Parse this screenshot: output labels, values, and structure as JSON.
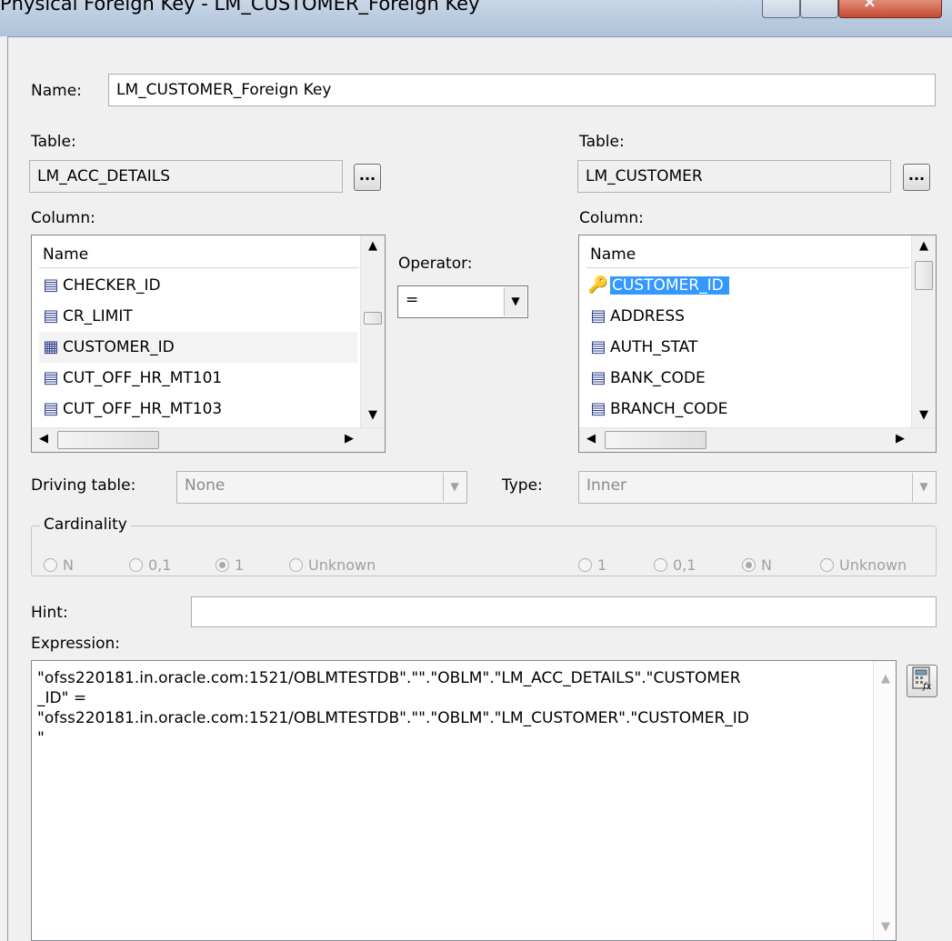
{
  "window": {
    "title": "Physical Foreign Key - LM_CUSTOMER_Foreign Key"
  },
  "name": {
    "label": "Name:",
    "value": "LM_CUSTOMER_Foreign Key"
  },
  "left": {
    "table_label": "Table:",
    "table_value": "LM_ACC_DETAILS",
    "browse_label": "...",
    "column_label": "Column:",
    "list_header": "Name",
    "columns": [
      {
        "name": "CHECKER_ID",
        "icon": "column-icon"
      },
      {
        "name": "CR_LIMIT",
        "icon": "column-icon"
      },
      {
        "name": "CUSTOMER_ID",
        "icon": "column-icon"
      },
      {
        "name": "CUT_OFF_HR_MT101",
        "icon": "column-icon"
      },
      {
        "name": "CUT_OFF_HR_MT103",
        "icon": "column-icon"
      }
    ]
  },
  "operator": {
    "label": "Operator:",
    "value": "="
  },
  "right": {
    "table_label": "Table:",
    "table_value": "LM_CUSTOMER",
    "browse_label": "...",
    "column_label": "Column:",
    "list_header": "Name",
    "columns": [
      {
        "name": "CUSTOMER_ID",
        "icon": "key-icon"
      },
      {
        "name": "ADDRESS",
        "icon": "column-icon"
      },
      {
        "name": "AUTH_STAT",
        "icon": "column-icon"
      },
      {
        "name": "BANK_CODE",
        "icon": "column-icon"
      },
      {
        "name": "BRANCH_CODE",
        "icon": "column-icon"
      }
    ]
  },
  "driving_table": {
    "label": "Driving table:",
    "value": "None"
  },
  "type": {
    "label": "Type:",
    "value": "Inner"
  },
  "cardinality": {
    "label": "Cardinality",
    "left_options": [
      "N",
      "0,1",
      "1",
      "Unknown"
    ],
    "left_selected": "1",
    "right_options": [
      "1",
      "0,1",
      "N",
      "Unknown"
    ],
    "right_selected": "N"
  },
  "hint": {
    "label": "Hint:",
    "value": ""
  },
  "expression": {
    "label": "Expression:",
    "lines": [
      "\"ofss220181.in.oracle.com:1521/OBLMTESTDB\".\"\".\"OBLM\".\"LM_ACC_DETAILS\".\"CUSTOMER",
      "_ID\" =",
      "\"ofss220181.in.oracle.com:1521/OBLMTESTDB\".\"\".\"OBLM\".\"LM_CUSTOMER\".\"CUSTOMER_ID",
      "\""
    ]
  },
  "colors": {
    "selection": "#3399ff",
    "column_icon": "#2d3c8c"
  }
}
